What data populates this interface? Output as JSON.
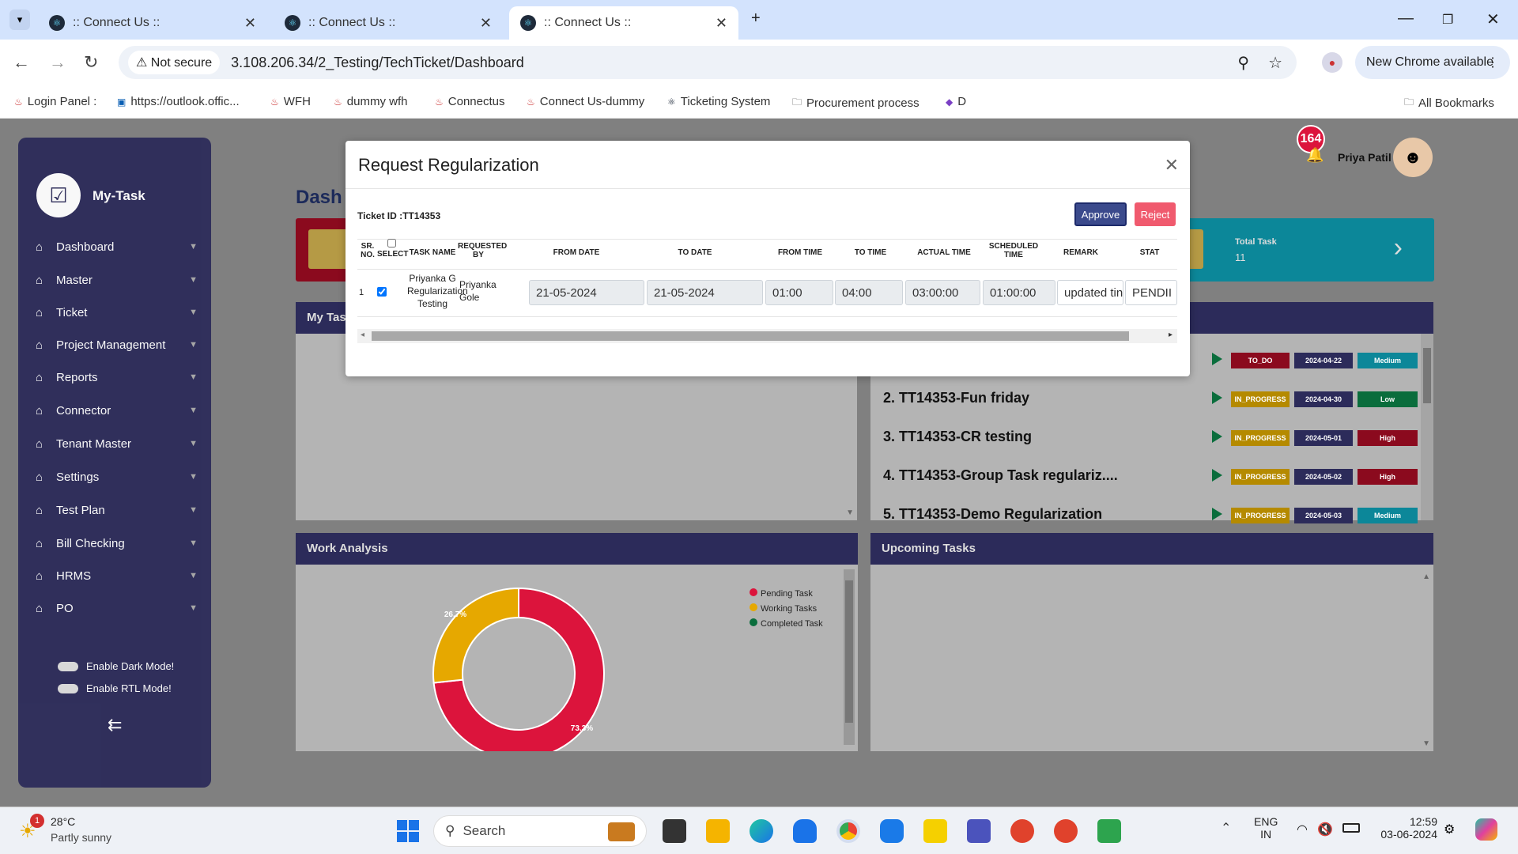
{
  "browser": {
    "tabs": [
      {
        "title": ":: Connect Us ::"
      },
      {
        "title": ":: Connect Us ::"
      },
      {
        "title": ":: Connect Us ::"
      }
    ],
    "not_secure": "Not secure",
    "url": "3.108.206.34/2_Testing/TechTicket/Dashboard",
    "new_chrome": "New Chrome available",
    "bookmarks": [
      "Login Panel :",
      "https://outlook.offic...",
      "WFH",
      "dummy wfh",
      "Connectus",
      "Connect Us-dummy",
      "Ticketing System",
      "Procurement process",
      "D",
      "All Bookmarks"
    ]
  },
  "sidebar": {
    "brand": "My-Task",
    "items": [
      "Dashboard",
      "Master",
      "Ticket",
      "Project Management",
      "Reports",
      "Connector",
      "Tenant Master",
      "Settings",
      "Test Plan",
      "Bill Checking",
      "HRMS",
      "PO"
    ],
    "dark_mode": "Enable Dark Mode!",
    "rtl_mode": "Enable RTL Mode!"
  },
  "header": {
    "title": "Dash",
    "notifications": "164",
    "user": "Priya Patil"
  },
  "cards": {
    "total_label": "Total Task",
    "total_value": "11"
  },
  "my_tasks": {
    "title": "My Tas",
    "tasks": [
      {
        "name": "",
        "status": "TO_DO",
        "date": "2024-04-22",
        "priority": "Medium"
      },
      {
        "name": "2. TT14353-Fun friday",
        "status": "IN_PROGRESS",
        "date": "2024-04-30",
        "priority": "Low"
      },
      {
        "name": "3. TT14353-CR testing",
        "status": "IN_PROGRESS",
        "date": "2024-05-01",
        "priority": "High"
      },
      {
        "name": "4. TT14353-Group Task regulariz....",
        "status": "IN_PROGRESS",
        "date": "2024-05-02",
        "priority": "High"
      },
      {
        "name": "5. TT14353-Demo Regularization",
        "status": "IN_PROGRESS",
        "date": "2024-05-03",
        "priority": "Medium"
      }
    ]
  },
  "work_analysis": {
    "title": "Work Analysis",
    "legend": [
      "Pending Task",
      "Working Tasks",
      "Completed Task"
    ]
  },
  "upcoming": {
    "title": "Upcoming Tasks"
  },
  "chart_data": {
    "type": "pie",
    "categories": [
      "Pending Task",
      "Working Tasks",
      "Completed Task"
    ],
    "values": [
      73.3,
      26.7,
      0
    ],
    "labels": [
      "73.3%",
      "26.7%"
    ],
    "colors": [
      "#dc143c",
      "#e6a800",
      "#0a6d3c"
    ]
  },
  "modal": {
    "title": "Request Regularization",
    "ticket": "Ticket ID :TT14353",
    "approve": "Approve",
    "reject": "Reject",
    "headers": [
      "SR. NO.",
      "SELECT",
      "TASK NAME",
      "REQUESTED BY",
      "FROM DATE",
      "TO DATE",
      "FROM TIME",
      "TO TIME",
      "ACTUAL TIME",
      "SCHEDULED TIME",
      "REMARK",
      "STAT"
    ],
    "row": {
      "sr": "1",
      "task": "Priyanka G Regularization Testing",
      "by": "Priyanka Gole",
      "from_date": "21-05-2024",
      "to_date": "21-05-2024",
      "from_time": "01:00",
      "to_time": "04:00",
      "actual": "03:00:00",
      "scheduled": "01:00:00",
      "remark": "updated tin",
      "status": "PENDII"
    }
  },
  "taskbar": {
    "temp": "28°C",
    "weather": "Partly sunny",
    "weather_badge": "1",
    "search": "Search",
    "lang1": "ENG",
    "lang2": "IN",
    "time": "12:59",
    "date": "03-06-2024"
  }
}
